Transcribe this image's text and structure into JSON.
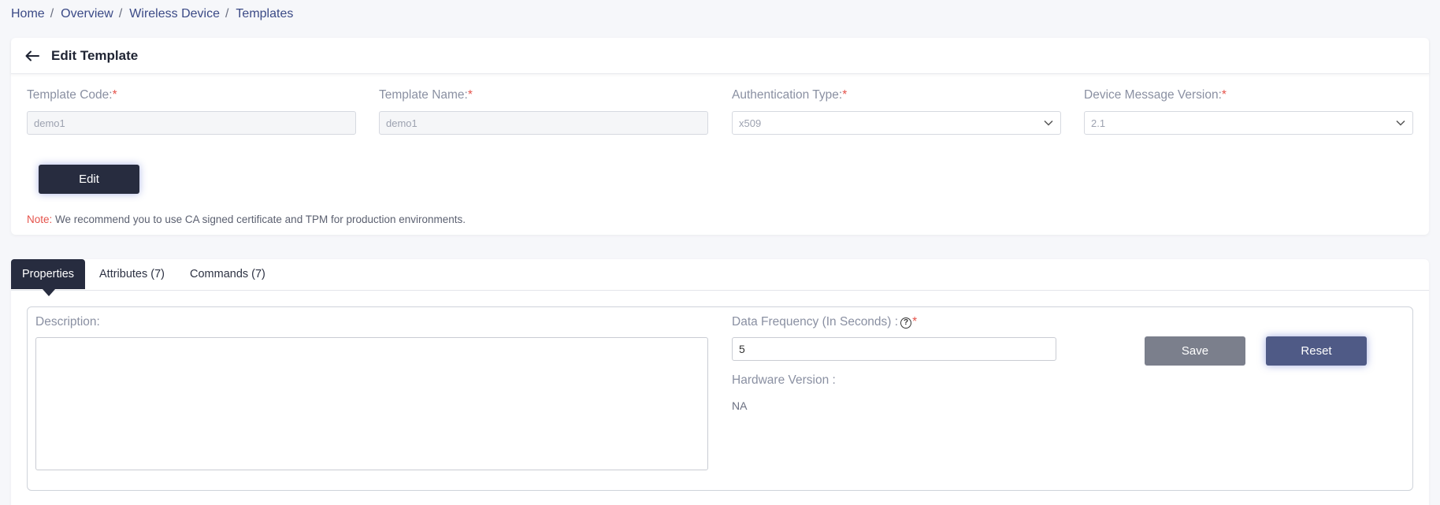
{
  "breadcrumb": {
    "items": [
      "Home",
      "Overview",
      "Wireless Device",
      "Templates"
    ],
    "separator": "/"
  },
  "header": {
    "title": "Edit Template"
  },
  "form": {
    "template_code": {
      "label": "Template Code:",
      "required_mark": "*",
      "value": "demo1"
    },
    "template_name": {
      "label": "Template Name:",
      "required_mark": "*",
      "value": "demo1"
    },
    "auth_type": {
      "label": "Authentication Type:",
      "required_mark": "*",
      "value": "x509"
    },
    "device_message_version": {
      "label": "Device Message Version:",
      "required_mark": "*",
      "value": "2.1"
    },
    "edit_button": "Edit",
    "note_label": "Note:",
    "note_text": " We recommend you to use CA signed certificate and TPM for production environments."
  },
  "tabs": [
    {
      "label": "Properties",
      "active": true
    },
    {
      "label": "Attributes (7)",
      "active": false
    },
    {
      "label": "Commands (7)",
      "active": false
    }
  ],
  "properties": {
    "description_label": "Description:",
    "description_value": "",
    "data_frequency_label": "Data Frequency (In Seconds) :",
    "help_glyph": "?",
    "data_frequency_required": "*",
    "data_frequency_value": "5",
    "hardware_version_label": "Hardware Version :",
    "hardware_version_value": "NA",
    "save_button": "Save",
    "reset_button": "Reset"
  },
  "colors": {
    "accent_dark": "#272c3f",
    "required": "#e5534b",
    "link": "#3b4a86",
    "reset_button": "#4f5a86",
    "save_button": "#7b7f8c"
  }
}
